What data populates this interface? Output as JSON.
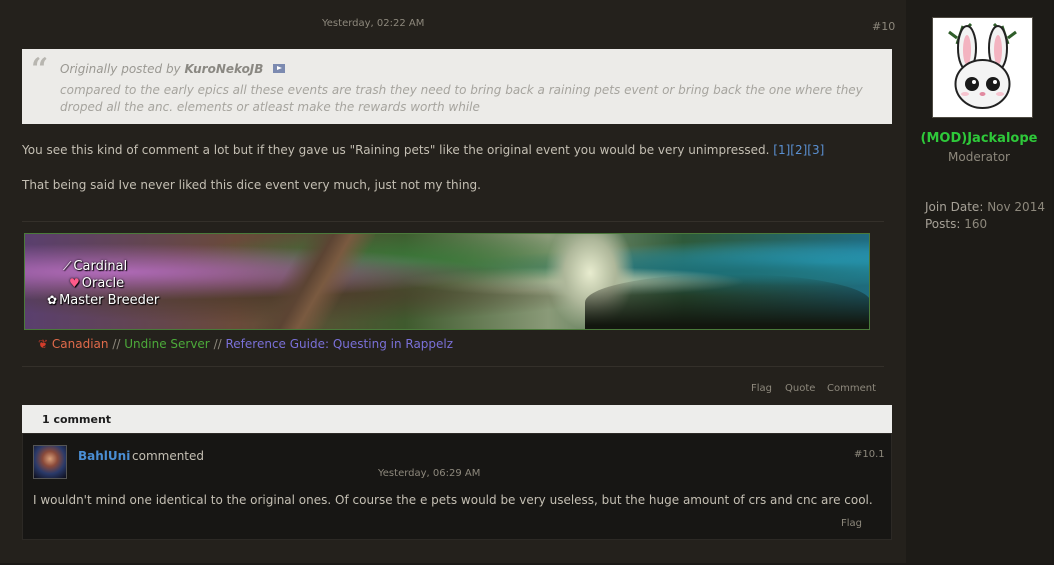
{
  "post": {
    "date": "Yesterday, 02:22 AM",
    "number": "#10",
    "quote": {
      "prefix": "Originally posted by",
      "author": "KuroNekoJB",
      "text": "compared to the early epics all these events are trash they need to bring back a raining pets event or bring back the one where they droped all the anc. elements or atleast make the rewards worth while"
    },
    "body": {
      "p1": "You see this kind of comment a lot but if they gave us \"Raining pets\" like the original event you would be very unimpressed.",
      "p1_refs": "[1][2][3]",
      "p2": "That being said Ive never liked this dice event very much, just not my thing."
    },
    "signature": {
      "labels": [
        "Cardinal",
        "Oracle",
        "Master Breeder"
      ],
      "footer": {
        "canadian": "Canadian",
        "sep": "//",
        "server": "Undine Server",
        "guide_prefix": "Reference Guide:",
        "guide_link": "Questing in Rappelz"
      }
    },
    "actions": {
      "flag": "Flag",
      "quote": "Quote",
      "comment": "Comment"
    }
  },
  "comments": {
    "header": "1 comment",
    "items": [
      {
        "author": "BahlUni",
        "verb": "commented",
        "date": "Yesterday, 06:29 AM",
        "number": "#10.1",
        "text": "I wouldn't mind one identical to the original ones. Of course the e pets would be very useless, but the huge amount of crs and cnc are cool.",
        "flag": "Flag"
      }
    ]
  },
  "user": {
    "username": "(MOD)Jackalope",
    "title": "Moderator",
    "join_label": "Join Date:",
    "join_value": "Nov 2014",
    "posts_label": "Posts:",
    "posts_value": "160"
  },
  "colors": {
    "username": "#2ec93a",
    "link": "#4a8ed4",
    "server": "#4caa3a",
    "guide": "#7a70d8",
    "canadian": "#e06a4a"
  }
}
